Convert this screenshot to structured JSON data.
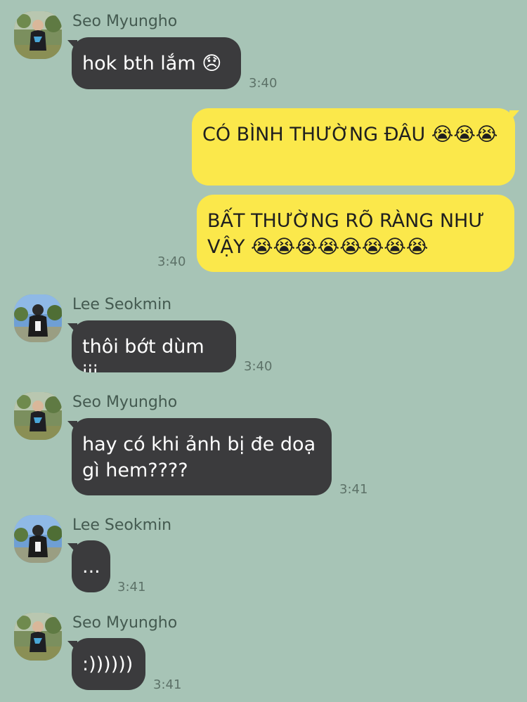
{
  "colors": {
    "background": "#a7c4b6",
    "incoming_bubble": "#3b3b3d",
    "outgoing_bubble": "#fbe84b"
  },
  "messages": [
    {
      "sender": "Seo Myungho",
      "text": "hok bth lắm 😞",
      "time": "3:40"
    },
    {
      "sender": "me",
      "text": "CÓ BÌNH THƯỜNG ĐÂU 😭😭😭"
    },
    {
      "sender": "me",
      "text": "BẤT THƯỜNG RÕ RÀNG NHƯ VẬY 😭😭😭😭😭😭😭😭",
      "time": "3:40"
    },
    {
      "sender": "Lee Seokmin",
      "text": "thôi bớt dùm iii",
      "time": "3:40"
    },
    {
      "sender": "Seo Myungho",
      "text": "hay có khi ảnh bị đe doạ gì hem????",
      "time": "3:41"
    },
    {
      "sender": "Lee Seokmin",
      "text": "...",
      "time": "3:41"
    },
    {
      "sender": "Seo Myungho",
      "text": ":))))))",
      "time": "3:41"
    }
  ]
}
